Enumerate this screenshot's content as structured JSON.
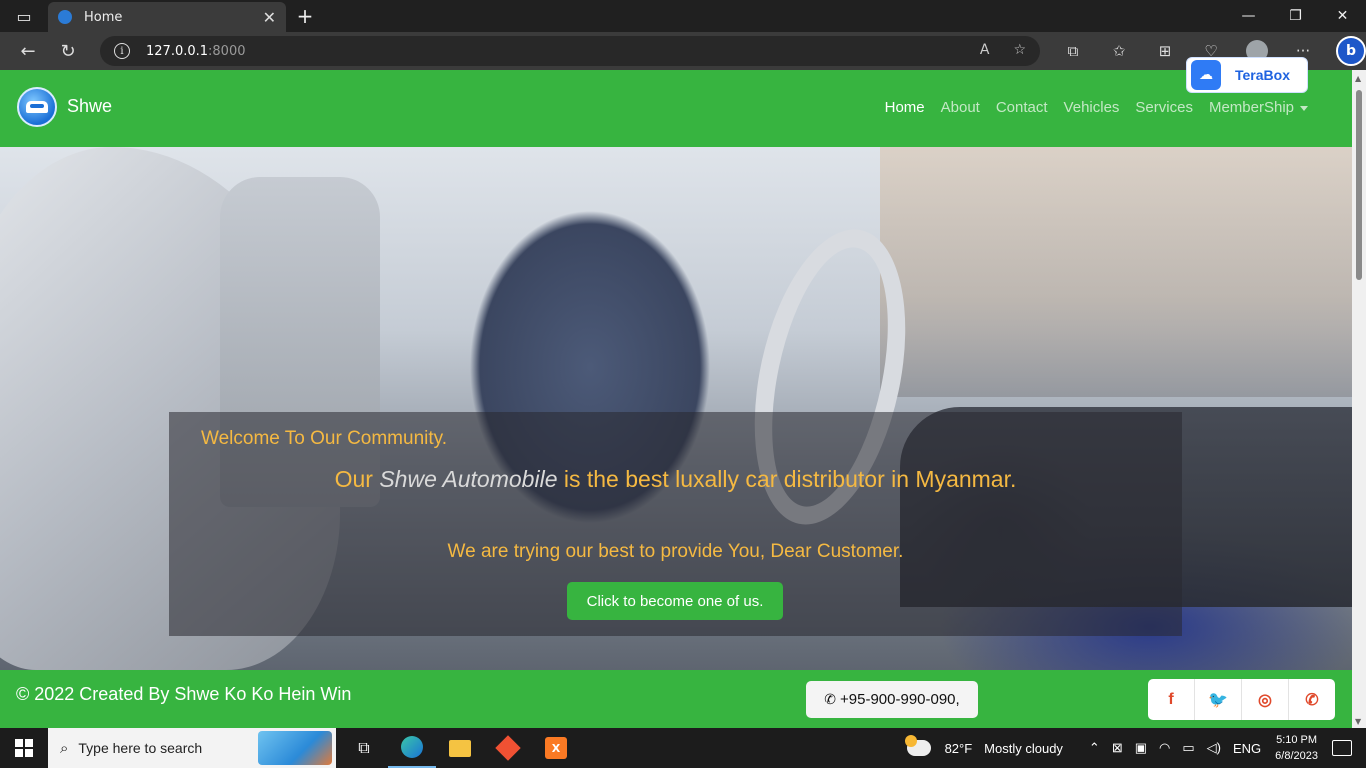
{
  "browser": {
    "tab_title": "Home",
    "tab_close": "✕",
    "new_tab": "+",
    "url_host": "127.0.0.1",
    "url_port": ":8000",
    "window_controls": [
      "—",
      "❐",
      "✕"
    ]
  },
  "extension": {
    "label": "TeraBox"
  },
  "navbar": {
    "brand": "Shwe",
    "items": [
      {
        "label": "Home",
        "active": true
      },
      {
        "label": "About"
      },
      {
        "label": "Contact"
      },
      {
        "label": "Vehicles"
      },
      {
        "label": "Services"
      },
      {
        "label": "MemberShip",
        "dropdown": true
      }
    ]
  },
  "hero": {
    "welcome": "Welcome To Our Community.",
    "headline_pre": "Our ",
    "headline_em": "Shwe Automobile",
    "headline_post": " is the best luxally car distributor in Myanmar.",
    "subline": "We are trying our best to provide You, Dear Customer.",
    "cta": "Click to become one of us."
  },
  "footer": {
    "copyright": "© 2022 Created By Shwe Ko Ko Hein Win",
    "phone": "+95-900-990-090,",
    "social": [
      "f",
      "t",
      "ig",
      "wa"
    ]
  },
  "taskbar": {
    "search_placeholder": "Type here to search",
    "weather_temp": "82°F",
    "weather_text": "Mostly cloudy",
    "language": "ENG",
    "time": "5:10 PM",
    "date": "6/8/2023"
  },
  "colors": {
    "brand_green": "#37b440",
    "accent_yellow": "#f5b942",
    "social_red": "#e0492b"
  }
}
